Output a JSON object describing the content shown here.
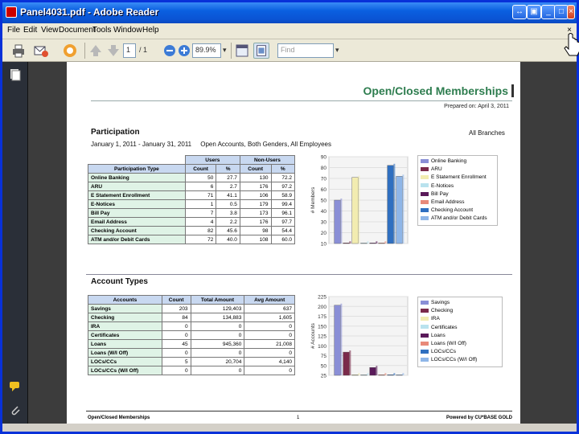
{
  "window": {
    "title": "Panel4031.pdf - Adobe Reader"
  },
  "menu": {
    "items": [
      "File",
      "Edit",
      "View",
      "Document",
      "Tools",
      "Window",
      "Help"
    ],
    "close": "×"
  },
  "toolbar": {
    "page_number": "1",
    "page_total": "/ 1",
    "zoom": "89.9%",
    "find_placeholder": "Find"
  },
  "page": {
    "title": "Open/Closed Memberships",
    "prepared": "Prepared on: April 3, 2011",
    "participation": {
      "title": "Participation",
      "right": "All Branches",
      "subtitle": "January 1, 2011 - January 31, 2011     Open Accounts, Both Genders, All Employees",
      "group_headers": [
        "Users",
        "Non-Users"
      ],
      "headers": [
        "Participation Type",
        "Count",
        "%",
        "Count",
        "%"
      ],
      "rows": [
        [
          "Online Banking",
          "50",
          "27.7",
          "130",
          "72.2"
        ],
        [
          "ARU",
          "6",
          "2.7",
          "176",
          "97.2"
        ],
        [
          "E Statement Enrollment",
          "71",
          "41.1",
          "106",
          "58.9"
        ],
        [
          "E-Notices",
          "1",
          "0.5",
          "179",
          "99.4"
        ],
        [
          "Bill Pay",
          "7",
          "3.8",
          "173",
          "96.1"
        ],
        [
          "Email Address",
          "4",
          "2.2",
          "176",
          "97.7"
        ],
        [
          "Checking Account",
          "82",
          "45.6",
          "98",
          "54.4"
        ],
        [
          "ATM and/or Debit Cards",
          "72",
          "40.0",
          "108",
          "60.0"
        ]
      ]
    },
    "account_types": {
      "title": "Account Types",
      "headers": [
        "Accounts",
        "Count",
        "Total Amount",
        "Avg Amount"
      ],
      "rows": [
        [
          "Savings",
          "203",
          "129,403",
          "637"
        ],
        [
          "Checking",
          "84",
          "134,883",
          "1,605"
        ],
        [
          "IRA",
          "0",
          "0",
          "0"
        ],
        [
          "Certificates",
          "0",
          "0",
          "0"
        ],
        [
          "Loans",
          "45",
          "945,360",
          "21,008"
        ],
        [
          "Loans    (W/I Off)",
          "0",
          "0",
          "0"
        ],
        [
          "LOCs/CCs",
          "5",
          "20,704",
          "4,140"
        ],
        [
          "LOCs/CCs (W/I Off)",
          "0",
          "0",
          "0"
        ]
      ]
    },
    "footer": {
      "left": "Open/Closed Memberships",
      "middle": "1",
      "right": "Powered by CU*BASE GOLD"
    }
  },
  "chart_data": [
    {
      "type": "bar",
      "ylabel": "# Members",
      "ylim": [
        10,
        90
      ],
      "yticks": [
        90,
        80,
        70,
        60,
        50,
        40,
        30,
        20,
        10
      ],
      "series": [
        {
          "name": "Online Banking",
          "values": [
            50
          ],
          "color": "#8a8fd6"
        },
        {
          "name": "ARU",
          "values": [
            6
          ],
          "color": "#7a2a4a"
        },
        {
          "name": "E Statement Enrollment",
          "values": [
            71
          ],
          "color": "#f2ecb0"
        },
        {
          "name": "E-Notices",
          "values": [
            1
          ],
          "color": "#b9e2ee"
        },
        {
          "name": "Bill Pay",
          "values": [
            7
          ],
          "color": "#5a1a5a"
        },
        {
          "name": "Email Address",
          "values": [
            4
          ],
          "color": "#e88a7a"
        },
        {
          "name": "Checking Account",
          "values": [
            82
          ],
          "color": "#2f6fc0"
        },
        {
          "name": "ATM and/or Debit Cards",
          "values": [
            72
          ],
          "color": "#8fb6e8"
        }
      ]
    },
    {
      "type": "bar",
      "ylabel": "# Accounts",
      "ylim": [
        25,
        225
      ],
      "yticks": [
        225,
        200,
        175,
        150,
        125,
        100,
        75,
        50,
        25
      ],
      "series": [
        {
          "name": "Savings",
          "values": [
            203
          ],
          "color": "#8a8fd6"
        },
        {
          "name": "Checking",
          "values": [
            84
          ],
          "color": "#7a2a4a"
        },
        {
          "name": "IRA",
          "values": [
            0
          ],
          "color": "#f2ecb0"
        },
        {
          "name": "Certificates",
          "values": [
            0
          ],
          "color": "#b9e2ee"
        },
        {
          "name": "Loans",
          "values": [
            45
          ],
          "color": "#5a1a5a"
        },
        {
          "name": "Loans     (W/I Off)",
          "values": [
            0
          ],
          "color": "#e88a7a"
        },
        {
          "name": "LOCs/CCs",
          "values": [
            5
          ],
          "color": "#2f6fc0"
        },
        {
          "name": "LOCs/CCs (W/I Off)",
          "values": [
            0
          ],
          "color": "#8fb6e8"
        }
      ]
    }
  ]
}
